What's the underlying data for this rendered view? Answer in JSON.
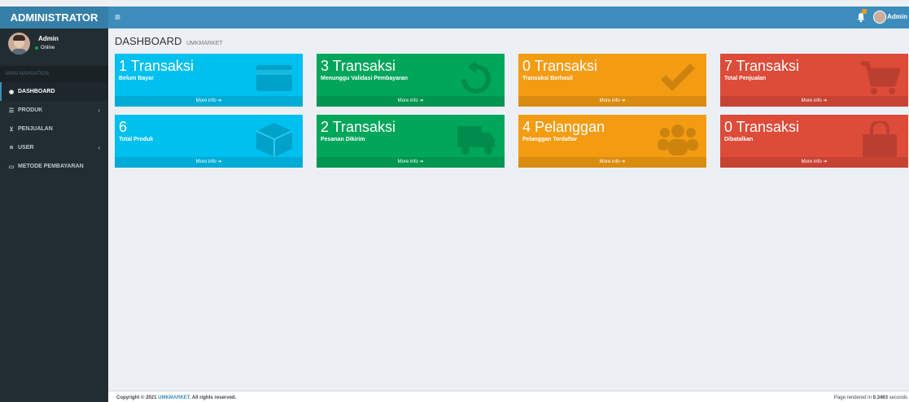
{
  "logo": "ADMINISTRATOR",
  "navbar": {
    "toggle": "≡",
    "user": "Admin",
    "bell_icon": "bell-icon"
  },
  "sidebar": {
    "user_name": "Admin",
    "status": "Online",
    "header": "MAIN NAVIGATION",
    "items": [
      {
        "label": "DASHBOARD",
        "icon": "dashboard-icon",
        "glyph": "◉",
        "active": true,
        "arrow": ""
      },
      {
        "label": "PRODUK",
        "icon": "database-icon",
        "glyph": "☰",
        "active": false,
        "arrow": "‹"
      },
      {
        "label": "PENJUALAN",
        "icon": "cart-icon",
        "glyph": "⊻",
        "active": false,
        "arrow": ""
      },
      {
        "label": "USER",
        "icon": "user-icon",
        "glyph": "⍝",
        "active": false,
        "arrow": "‹"
      },
      {
        "label": "METODE PEMBAYARAN",
        "icon": "card-icon",
        "glyph": "▭",
        "active": false,
        "arrow": ""
      }
    ]
  },
  "page": {
    "title": "DASHBOARD",
    "subtitle": "UMKMARKET"
  },
  "boxes": [
    {
      "count": "1 Transaksi",
      "label": "Belum Bayar",
      "more": "More info ➔",
      "color": "#00c0ef",
      "icon": "credit-card-icon"
    },
    {
      "count": "3 Transaksi",
      "label": "Menunggu Validasi Pembayaran",
      "more": "More info ➔",
      "color": "#00a65a",
      "icon": "refresh-icon"
    },
    {
      "count": "0 Transaksi",
      "label": "Transaksi Berhasil",
      "more": "More info ➔",
      "color": "#f39c12",
      "icon": "check-icon"
    },
    {
      "count": "7 Transaksi",
      "label": "Total Penjualan",
      "more": "More info ➔",
      "color": "#dd4b39",
      "icon": "cart-icon"
    },
    {
      "count": "6",
      "label": "Total Produk",
      "more": "More info ➔",
      "color": "#00c0ef",
      "icon": "cube-icon"
    },
    {
      "count": "2 Transaksi",
      "label": "Pesanan Dikirim",
      "more": "More info ➔",
      "color": "#00a65a",
      "icon": "truck-icon"
    },
    {
      "count": "4 Pelanggan",
      "label": "Pelanggan Terdaftar",
      "more": "More info ➔",
      "color": "#f39c12",
      "icon": "users-icon"
    },
    {
      "count": "0 Transaksi",
      "label": "Dibatalkan",
      "more": "More info ➔",
      "color": "#dd4b39",
      "icon": "shopping-bag-icon"
    }
  ],
  "footer": {
    "copyright_prefix": "Copyright © 2021 ",
    "brand": "UMKMARKET",
    "copyright_suffix": ". All rights reserved.",
    "rendered_prefix": "Page rendered in ",
    "rendered_time": "0.3463",
    "rendered_suffix": " seconds"
  }
}
